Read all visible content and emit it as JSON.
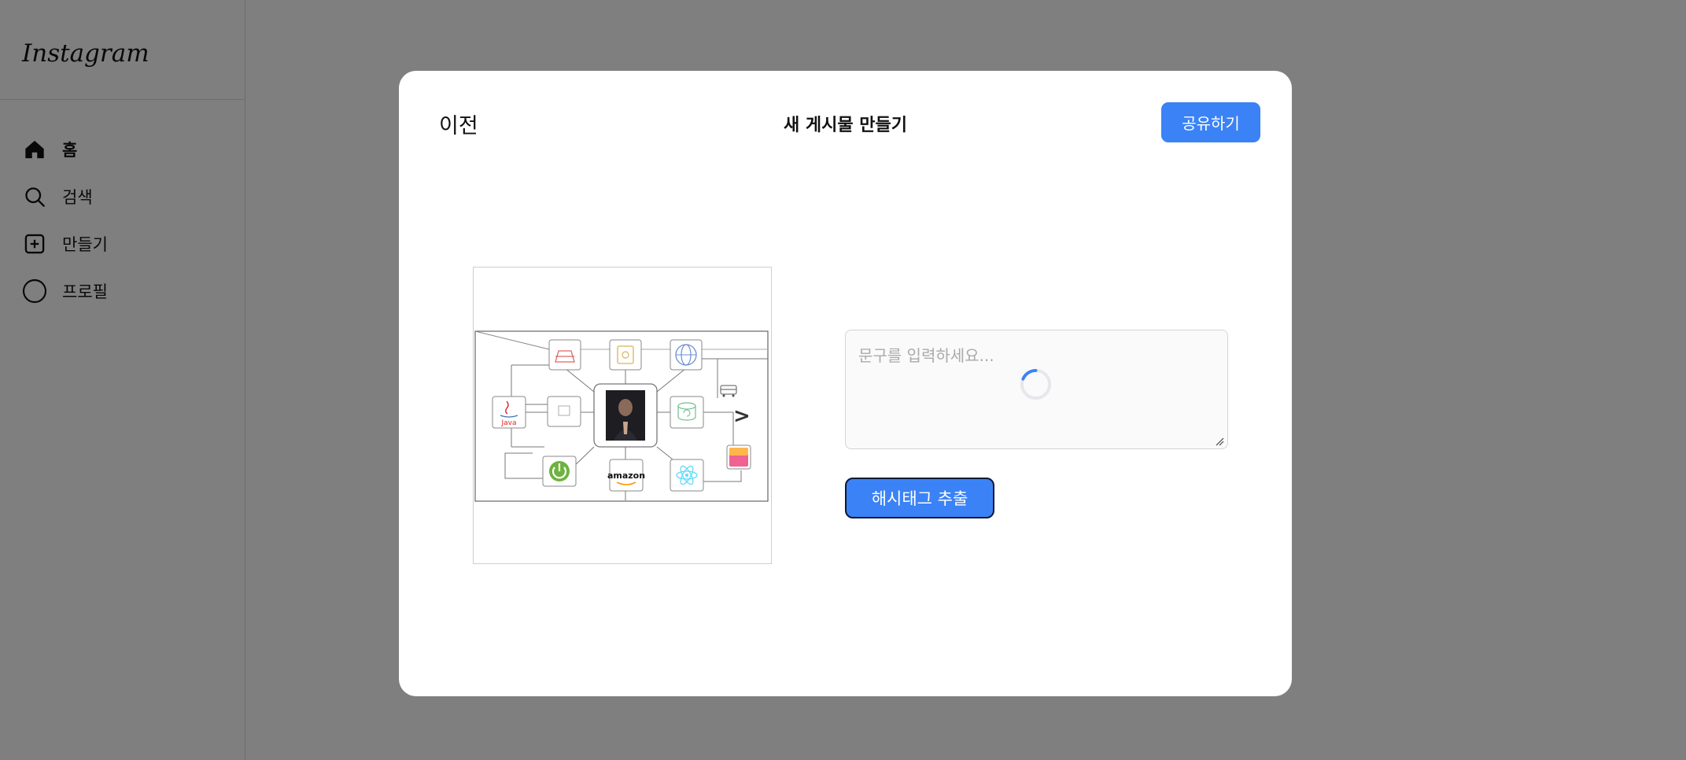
{
  "app": {
    "logo_text": "Instagram"
  },
  "sidebar": {
    "items": [
      {
        "label": "홈",
        "icon": "home-icon"
      },
      {
        "label": "검색",
        "icon": "search-icon"
      },
      {
        "label": "만들기",
        "icon": "plus-square-icon"
      },
      {
        "label": "프로필",
        "icon": "profile-circle-icon"
      }
    ]
  },
  "modal": {
    "title": "새 게시물 만들기",
    "back_label": "이전",
    "share_label": "공유하기",
    "caption_placeholder": "문구를 입력하세요...",
    "caption_value": "",
    "hashtag_button_label": "해시태그 추출",
    "loading": true
  },
  "preview": {
    "labels": {
      "java": "Java",
      "amazon": "amazon"
    }
  },
  "colors": {
    "accent": "#3b82f6",
    "overlay": "rgba(0,0,0,0.5)",
    "spring_green": "#6db33f",
    "react_blue": "#61dafb",
    "java_red": "#e11f21"
  }
}
